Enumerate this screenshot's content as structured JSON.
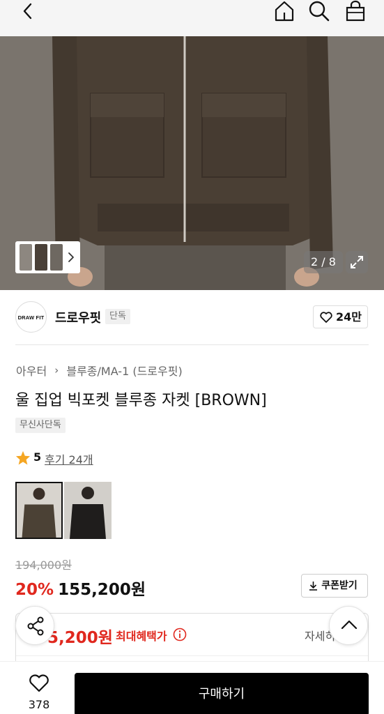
{
  "header": {
    "back_icon": "chevron-left-icon",
    "home_icon": "home-icon",
    "search_icon": "search-icon",
    "cart_icon": "shopping-bag-icon"
  },
  "gallery": {
    "counter": "2 / 8",
    "expand_icon": "expand-icon"
  },
  "brand": {
    "logo_text": "DRAW FIT",
    "name": "드로우핏",
    "badge": "단독",
    "likes": "24만"
  },
  "product": {
    "breadcrumb": [
      "아우터",
      "블루종/MA-1 (드로우핏)"
    ],
    "title": "울 집업 빅포켓 블루종 자켓 [BROWN]",
    "exclusive_tag": "무신사단독",
    "rating": "5",
    "reviews_label": "후기 24개",
    "star_color": "#f5a623"
  },
  "price": {
    "original": "194,000원",
    "discount": "20%",
    "sale": "155,200원",
    "coupon_label": "쿠폰받기",
    "max_benefit_price": "5,200원",
    "max_benefit_label": "최대혜택가",
    "detail_label": "자세히",
    "accent_color": "#e0281e"
  },
  "bottom_bar": {
    "wish_count": "378",
    "buy_label": "구매하기"
  }
}
